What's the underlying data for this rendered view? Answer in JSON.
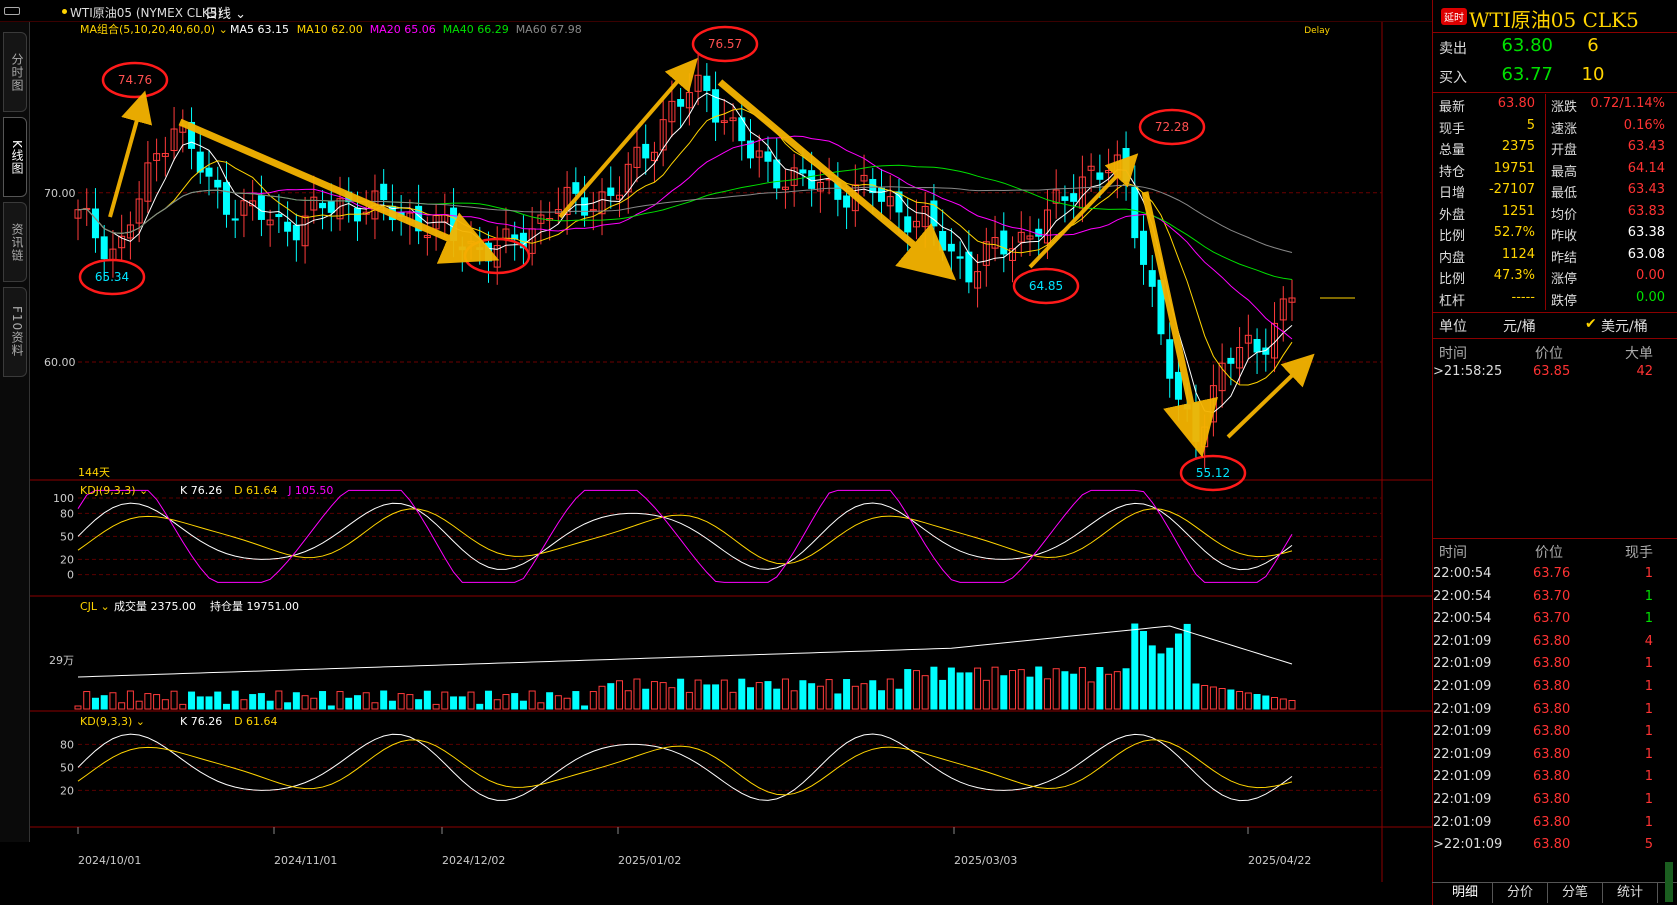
{
  "window": {
    "instrument": "WTI原油05 (NYMEX CLK5)",
    "period": "日线"
  },
  "left_tabs": [
    "分时图",
    "K线图",
    "资讯链",
    "F10资料"
  ],
  "main_indicator": {
    "label": "MA组合(5,10,20,40,60,0)",
    "items": [
      {
        "text": "MA5 63.15",
        "color": "#ffffff"
      },
      {
        "text": "MA10 62.00",
        "color": "#ffd400"
      },
      {
        "text": "MA20 65.06",
        "color": "#ff00ff"
      },
      {
        "text": "MA40 66.29",
        "color": "#00e000"
      },
      {
        "text": "MA60 67.98",
        "color": "#888888"
      }
    ],
    "delay": "Delay",
    "days": "144天",
    "price_ticks": [
      "70.00",
      "60.00"
    ]
  },
  "annotations": [
    "74.76",
    "65.34",
    "76.57",
    "64.85",
    "72.28",
    "55.12"
  ],
  "kdj": {
    "label": "KDJ(9,3,3)",
    "items": [
      {
        "text": "K 76.26",
        "color": "#ffffff"
      },
      {
        "text": "D 61.64",
        "color": "#ffd400"
      },
      {
        "text": "J 105.50",
        "color": "#ff00ff"
      }
    ],
    "ticks": [
      "100",
      "80",
      "50",
      "20",
      "0"
    ]
  },
  "cjl": {
    "label": "CJL",
    "items": [
      {
        "text": "成交量 2375.00",
        "color": "#ffffff"
      },
      {
        "text": "持仓量 19751.00",
        "color": "#ffffff"
      }
    ],
    "tick": "29万"
  },
  "kd": {
    "label": "KD(9,3,3)",
    "items": [
      {
        "text": "K 76.26",
        "color": "#ffffff"
      },
      {
        "text": "D 61.64",
        "color": "#ffd400"
      }
    ],
    "ticks": [
      "80",
      "50",
      "20"
    ]
  },
  "dates": [
    "2024/10/01",
    "2024/11/01",
    "2024/12/02",
    "2025/01/02",
    "2025/03/03",
    "2025/04/22"
  ],
  "quote": {
    "badge": "延时",
    "title": "WTI原油05  CLK5",
    "sell": {
      "label": "卖出",
      "price": "63.80",
      "qty": "6"
    },
    "buy": {
      "label": "买入",
      "price": "63.77",
      "qty": "10"
    },
    "grid": [
      {
        "l1": "最新",
        "v1": "63.80",
        "c1": "red",
        "l2": "涨跌",
        "v2": "0.72/1.14%",
        "c2": "red"
      },
      {
        "l1": "现手",
        "v1": "5",
        "c1": "yellow",
        "l2": "速涨",
        "v2": "0.16%",
        "c2": "red"
      },
      {
        "l1": "总量",
        "v1": "2375",
        "c1": "yellow",
        "l2": "开盘",
        "v2": "63.43",
        "c2": "red"
      },
      {
        "l1": "持仓",
        "v1": "19751",
        "c1": "yellow",
        "l2": "最高",
        "v2": "64.14",
        "c2": "red"
      },
      {
        "l1": "日增",
        "v1": "-27107",
        "c1": "yellow",
        "l2": "最低",
        "v2": "63.43",
        "c2": "red"
      },
      {
        "l1": "外盘",
        "v1": "1251",
        "c1": "yellow",
        "l2": "均价",
        "v2": "63.83",
        "c2": "red"
      },
      {
        "l1": "比例",
        "v1": "52.7%",
        "c1": "yellow",
        "l2": "昨收",
        "v2": "63.38",
        "c2": "white"
      },
      {
        "l1": "内盘",
        "v1": "1124",
        "c1": "yellow",
        "l2": "昨结",
        "v2": "63.08",
        "c2": "white"
      },
      {
        "l1": "比例",
        "v1": "47.3%",
        "c1": "yellow",
        "l2": "涨停",
        "v2": "0.00",
        "c2": "red"
      },
      {
        "l1": "杠杆",
        "v1": "-----",
        "c1": "yellow",
        "l2": "跌停",
        "v2": "0.00",
        "c2": "green"
      }
    ],
    "unit_label": "单位",
    "unit_a": "元/桶",
    "unit_b": "美元/桶"
  },
  "big_orders": {
    "headers": [
      "时间",
      "价位",
      "大单"
    ],
    "rows": [
      {
        "time": ">21:58:25",
        "price": "63.85",
        "vol": "42"
      }
    ]
  },
  "ticks_table": {
    "headers": [
      "时间",
      "价位",
      "现手"
    ],
    "rows": [
      {
        "time": "22:00:54",
        "price": "63.76",
        "vol": "1",
        "vc": "red"
      },
      {
        "time": "22:00:54",
        "price": "63.70",
        "vol": "1",
        "vc": "green"
      },
      {
        "time": "22:00:54",
        "price": "63.70",
        "vol": "1",
        "vc": "green"
      },
      {
        "time": "22:01:09",
        "price": "63.80",
        "vol": "4",
        "vc": "red"
      },
      {
        "time": "22:01:09",
        "price": "63.80",
        "vol": "1",
        "vc": "red"
      },
      {
        "time": "22:01:09",
        "price": "63.80",
        "vol": "1",
        "vc": "red"
      },
      {
        "time": "22:01:09",
        "price": "63.80",
        "vol": "1",
        "vc": "red"
      },
      {
        "time": "22:01:09",
        "price": "63.80",
        "vol": "1",
        "vc": "red"
      },
      {
        "time": "22:01:09",
        "price": "63.80",
        "vol": "1",
        "vc": "red"
      },
      {
        "time": "22:01:09",
        "price": "63.80",
        "vol": "1",
        "vc": "red"
      },
      {
        "time": "22:01:09",
        "price": "63.80",
        "vol": "1",
        "vc": "red"
      },
      {
        "time": "22:01:09",
        "price": "63.80",
        "vol": "1",
        "vc": "red"
      },
      {
        "time": ">22:01:09",
        "price": "63.80",
        "vol": "5",
        "vc": "red"
      }
    ]
  },
  "bottom_tabs": [
    "明细",
    "分价",
    "分笔",
    "统计"
  ]
}
